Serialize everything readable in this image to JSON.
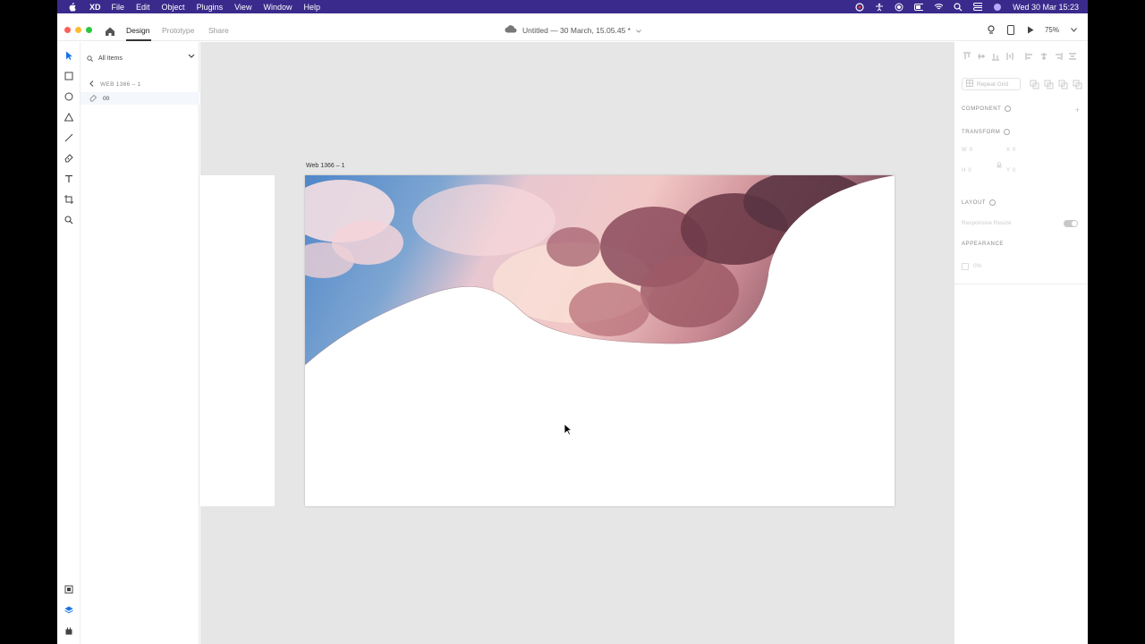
{
  "menubar": {
    "app_name": "XD",
    "menus": [
      "File",
      "Edit",
      "Object",
      "Plugins",
      "View",
      "Window",
      "Help"
    ],
    "clock": "Wed 30 Mar  15:23"
  },
  "window": {
    "tabs": {
      "design": "Design",
      "prototype": "Prototype",
      "share": "Share"
    },
    "doc_title": "Untitled — 30 March, 15.05.45 *",
    "zoom": "75%"
  },
  "layers": {
    "filter_label": "All Items",
    "artboard_name": "WEB 1366 – 1",
    "layer_name": "00"
  },
  "canvas": {
    "artboard_label": "Web 1366 – 1"
  },
  "inspector": {
    "repeat_grid": "Repeat Grid",
    "component_label": "COMPONENT",
    "transform_label": "TRANSFORM",
    "w_label": "W",
    "w_value": "0",
    "x_label": "X",
    "x_value": "0",
    "h_label": "H",
    "h_value": "0",
    "y_label": "Y",
    "y_value": "0",
    "layout_label": "LAYOUT",
    "responsive_resize": "Responsive Resize",
    "appearance_label": "APPEARANCE",
    "fill_label": "0%"
  },
  "colors": {
    "menubar": "#3a2a8c",
    "canvas": "#e6e6e6",
    "accent": "#1473e6"
  }
}
